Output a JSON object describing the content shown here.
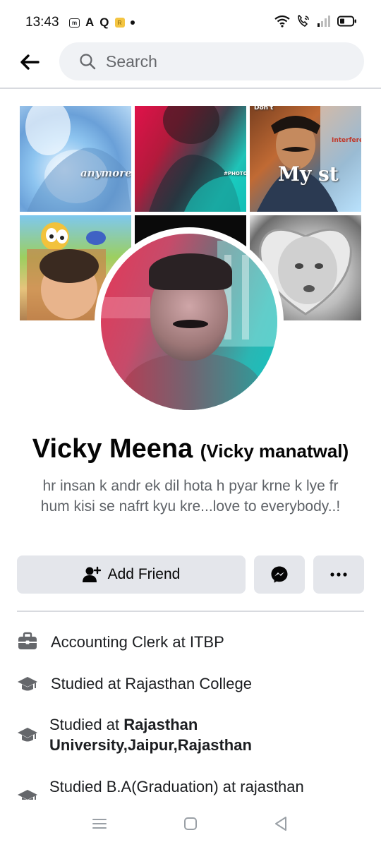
{
  "status_bar": {
    "time": "13:43",
    "left_icons": [
      "m-app-icon",
      "a-app-icon",
      "q-app-icon",
      "yellow-app-icon",
      "dot-icon"
    ],
    "m_label": "m",
    "a_label": "A",
    "q_label": "Q",
    "r_label": "R",
    "right_icons": [
      "wifi-icon",
      "call-icon",
      "signal-icon",
      "battery-icon"
    ]
  },
  "header": {
    "search_placeholder": "Search"
  },
  "cover": {
    "tile1_text": "anymore",
    "tile3_top_text": "Don't",
    "tile3_text": "My st",
    "tile3_side": "Interfere",
    "tile2_tag": "#PHOTOLAB"
  },
  "profile": {
    "name": "Vicky Meena",
    "alternate_name": "(Vicky manatwal)",
    "bio": "hr insan k andr ek dil hota h pyar krne k lye fr hum kisi se nafrt kyu kre...love to everybody..!"
  },
  "actions": {
    "add_friend_label": "Add Friend"
  },
  "details": [
    {
      "icon": "briefcase-icon",
      "text": "Accounting Clerk at ITBP"
    },
    {
      "icon": "graduation-cap-icon",
      "text": "Studied at Rajasthan College"
    },
    {
      "icon": "graduation-cap-icon",
      "prefix": "Studied at ",
      "bold_line1": "Rajasthan",
      "bold_line2": "University,Jaipur,Rajasthan"
    },
    {
      "icon": "graduation-cap-icon",
      "text": "Studied B.A(Graduation) at rajasthan"
    }
  ],
  "colors": {
    "button_bg": "#e4e6eb",
    "search_bg": "#f0f2f5",
    "secondary_text": "#5f6368"
  }
}
